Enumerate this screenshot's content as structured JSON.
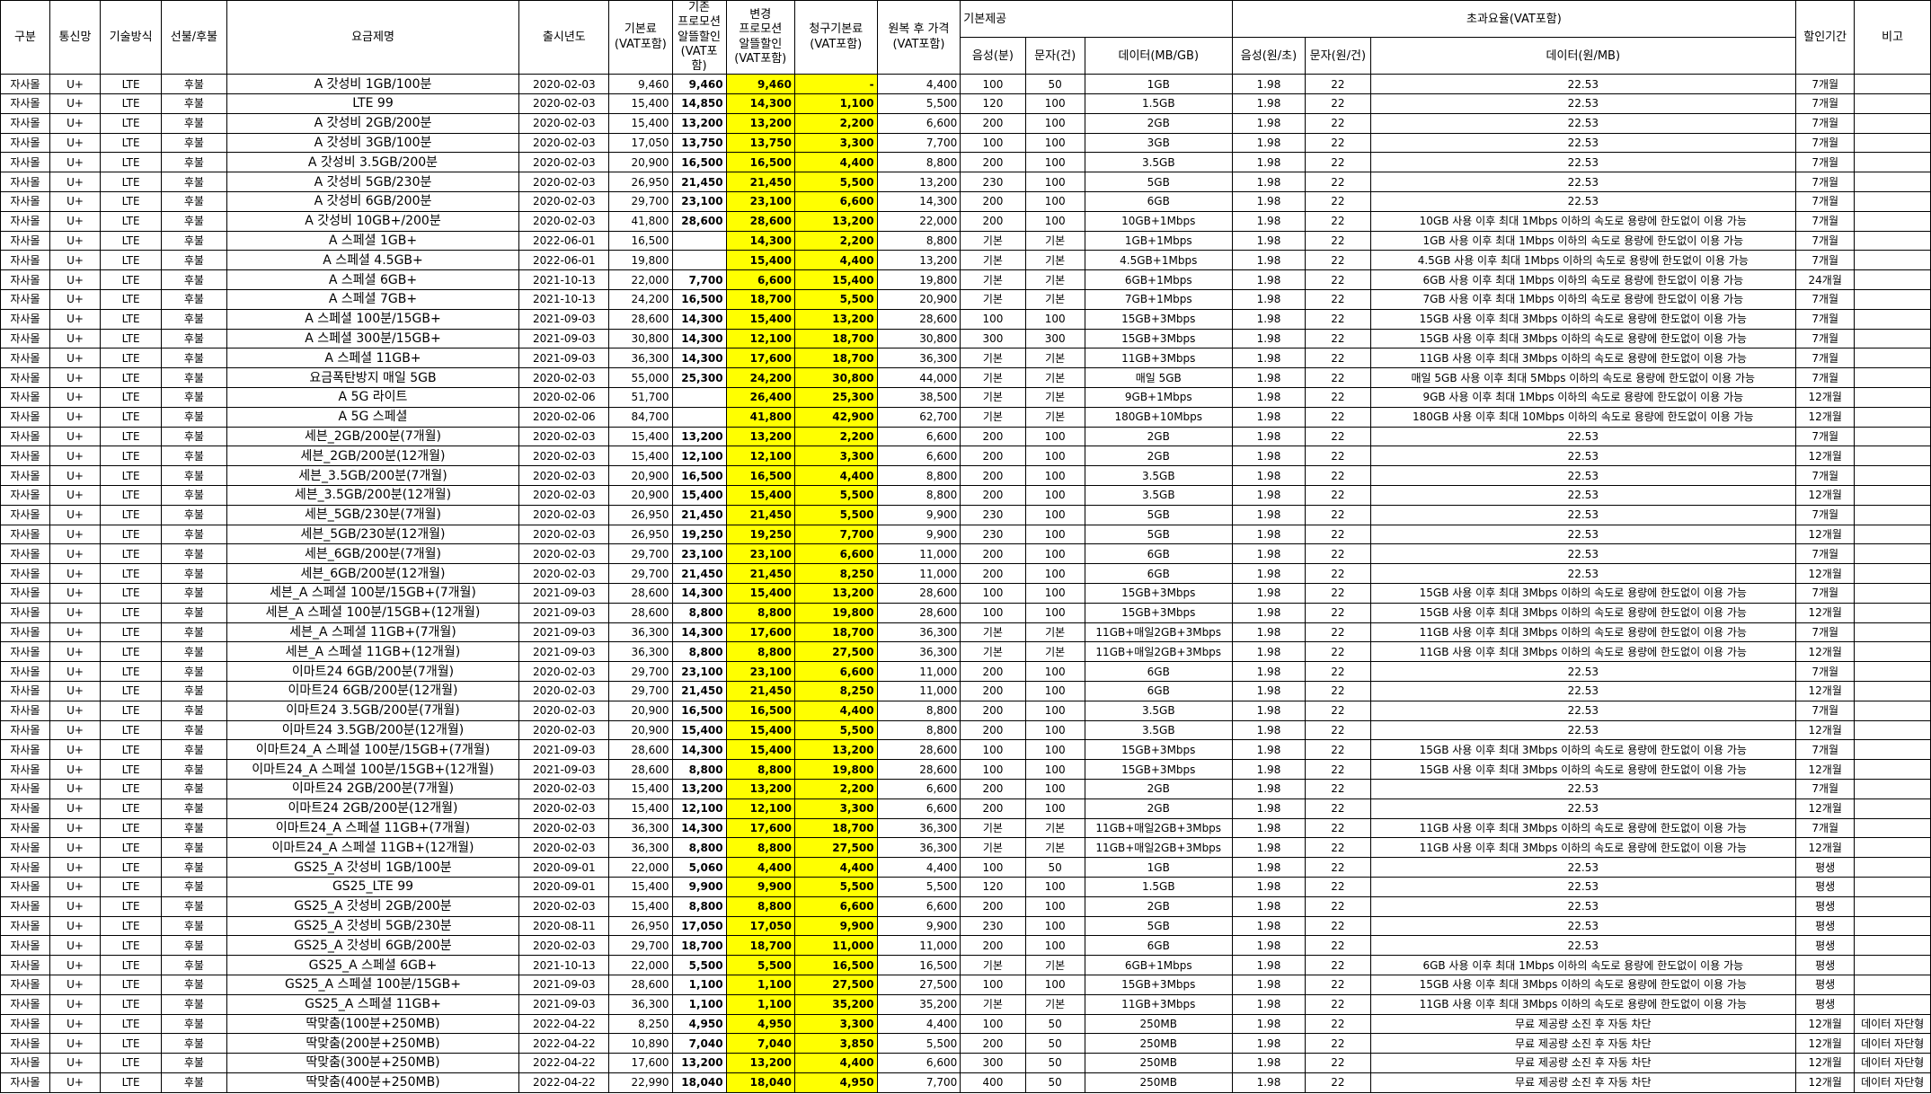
{
  "headers": {
    "category": "구분",
    "carrier": "통신망",
    "tech": "기술방식",
    "payment": "선불/후불",
    "plan": "요금제명",
    "release": "출시년도",
    "base_fee": "기본료\n(VAT포함)",
    "old_promo": "기존\n프로모션\n알뜰할인\n(VAT포함)",
    "new_promo": "변경\n프로모션\n알뜰할인\n(VAT포함)",
    "billed_fee": "청구기본료\n(VAT포함)",
    "restored_price": "원복 후 가격\n(VAT포함)",
    "basic_group": "기본제공",
    "voice": "음성(분)",
    "sms": "문자(건)",
    "data": "데이터(MB/GB)",
    "overage_group": "초과요율(VAT포함)",
    "ov_voice": "음성(원/초)",
    "ov_sms": "문자(원/건)",
    "ov_data": "데이터(원/MB)",
    "discount_period": "할인기간",
    "remarks": "비고"
  },
  "rows": [
    [
      "자사몰",
      "U+",
      "LTE",
      "후불",
      "A 갓성비 1GB/100분",
      "2020-02-03",
      "9,460",
      "9,460",
      "9,460",
      "-",
      "4,400",
      "100",
      "50",
      "1GB",
      "1.98",
      "22",
      "22.53",
      "7개월",
      ""
    ],
    [
      "자사몰",
      "U+",
      "LTE",
      "후불",
      "LTE 99",
      "2020-02-03",
      "15,400",
      "14,850",
      "14,300",
      "1,100",
      "5,500",
      "120",
      "100",
      "1.5GB",
      "1.98",
      "22",
      "22.53",
      "7개월",
      ""
    ],
    [
      "자사몰",
      "U+",
      "LTE",
      "후불",
      "A 갓성비 2GB/200분",
      "2020-02-03",
      "15,400",
      "13,200",
      "13,200",
      "2,200",
      "6,600",
      "200",
      "100",
      "2GB",
      "1.98",
      "22",
      "22.53",
      "7개월",
      ""
    ],
    [
      "자사몰",
      "U+",
      "LTE",
      "후불",
      "A 갓성비 3GB/100분",
      "2020-02-03",
      "17,050",
      "13,750",
      "13,750",
      "3,300",
      "7,700",
      "100",
      "100",
      "3GB",
      "1.98",
      "22",
      "22.53",
      "7개월",
      ""
    ],
    [
      "자사몰",
      "U+",
      "LTE",
      "후불",
      "A 갓성비 3.5GB/200분",
      "2020-02-03",
      "20,900",
      "16,500",
      "16,500",
      "4,400",
      "8,800",
      "200",
      "100",
      "3.5GB",
      "1.98",
      "22",
      "22.53",
      "7개월",
      ""
    ],
    [
      "자사몰",
      "U+",
      "LTE",
      "후불",
      "A 갓성비 5GB/230분",
      "2020-02-03",
      "26,950",
      "21,450",
      "21,450",
      "5,500",
      "13,200",
      "230",
      "100",
      "5GB",
      "1.98",
      "22",
      "22.53",
      "7개월",
      ""
    ],
    [
      "자사몰",
      "U+",
      "LTE",
      "후불",
      "A 갓성비 6GB/200분",
      "2020-02-03",
      "29,700",
      "23,100",
      "23,100",
      "6,600",
      "14,300",
      "200",
      "100",
      "6GB",
      "1.98",
      "22",
      "22.53",
      "7개월",
      ""
    ],
    [
      "자사몰",
      "U+",
      "LTE",
      "후불",
      "A 갓성비 10GB+/200분",
      "2020-02-03",
      "41,800",
      "28,600",
      "28,600",
      "13,200",
      "22,000",
      "200",
      "100",
      "10GB+1Mbps",
      "1.98",
      "22",
      "10GB 사용 이후 최대 1Mbps 이하의 속도로 용량에 한도없이 이용 가능",
      "7개월",
      ""
    ],
    [
      "자사몰",
      "U+",
      "LTE",
      "후불",
      "A 스페셜 1GB+",
      "2022-06-01",
      "16,500",
      "",
      "14,300",
      "2,200",
      "8,800",
      "기본",
      "기본",
      "1GB+1Mbps",
      "1.98",
      "22",
      "1GB 사용 이후 최대 1Mbps 이하의 속도로 용량에 한도없이 이용 가능",
      "7개월",
      ""
    ],
    [
      "자사몰",
      "U+",
      "LTE",
      "후불",
      "A 스페셜 4.5GB+",
      "2022-06-01",
      "19,800",
      "",
      "15,400",
      "4,400",
      "13,200",
      "기본",
      "기본",
      "4.5GB+1Mbps",
      "1.98",
      "22",
      "4.5GB 사용 이후 최대 1Mbps 이하의 속도로 용량에 한도없이 이용 가능",
      "7개월",
      ""
    ],
    [
      "자사몰",
      "U+",
      "LTE",
      "후불",
      "A 스페셜 6GB+",
      "2021-10-13",
      "22,000",
      "7,700",
      "6,600",
      "15,400",
      "19,800",
      "기본",
      "기본",
      "6GB+1Mbps",
      "1.98",
      "22",
      "6GB 사용 이후 최대 1Mbps 이하의 속도로 용량에 한도없이 이용 가능",
      "24개월",
      ""
    ],
    [
      "자사몰",
      "U+",
      "LTE",
      "후불",
      "A 스페셜 7GB+",
      "2021-10-13",
      "24,200",
      "16,500",
      "18,700",
      "5,500",
      "20,900",
      "기본",
      "기본",
      "7GB+1Mbps",
      "1.98",
      "22",
      "7GB 사용 이후 최대 1Mbps 이하의 속도로 용량에 한도없이 이용 가능",
      "7개월",
      ""
    ],
    [
      "자사몰",
      "U+",
      "LTE",
      "후불",
      "A 스페셜 100분/15GB+",
      "2021-09-03",
      "28,600",
      "14,300",
      "15,400",
      "13,200",
      "28,600",
      "100",
      "100",
      "15GB+3Mbps",
      "1.98",
      "22",
      "15GB 사용 이후 최대 3Mbps 이하의 속도로 용량에 한도없이 이용 가능",
      "7개월",
      ""
    ],
    [
      "자사몰",
      "U+",
      "LTE",
      "후불",
      "A 스페셜 300분/15GB+",
      "2021-09-03",
      "30,800",
      "14,300",
      "12,100",
      "18,700",
      "30,800",
      "300",
      "300",
      "15GB+3Mbps",
      "1.98",
      "22",
      "15GB 사용 이후 최대 3Mbps 이하의 속도로 용량에 한도없이 이용 가능",
      "7개월",
      ""
    ],
    [
      "자사몰",
      "U+",
      "LTE",
      "후불",
      "A 스페셜 11GB+",
      "2021-09-03",
      "36,300",
      "14,300",
      "17,600",
      "18,700",
      "36,300",
      "기본",
      "기본",
      "11GB+3Mbps",
      "1.98",
      "22",
      "11GB 사용 이후 최대 3Mbps 이하의 속도로 용량에 한도없이 이용 가능",
      "7개월",
      ""
    ],
    [
      "자사몰",
      "U+",
      "LTE",
      "후불",
      "요금폭탄방지 매일 5GB",
      "2020-02-03",
      "55,000",
      "25,300",
      "24,200",
      "30,800",
      "44,000",
      "기본",
      "기본",
      "매일 5GB",
      "1.98",
      "22",
      "매일 5GB 사용 이후 최대 5Mbps 이하의 속도로 용량에 한도없이 이용 가능",
      "7개월",
      ""
    ],
    [
      "자사몰",
      "U+",
      "LTE",
      "후불",
      "A 5G 라이트",
      "2020-02-06",
      "51,700",
      "",
      "26,400",
      "25,300",
      "38,500",
      "기본",
      "기본",
      "9GB+1Mbps",
      "1.98",
      "22",
      "9GB 사용 이후 최대 1Mbps 이하의 속도로 용량에 한도없이 이용 가능",
      "12개월",
      ""
    ],
    [
      "자사몰",
      "U+",
      "LTE",
      "후불",
      "A 5G 스페셜",
      "2020-02-06",
      "84,700",
      "",
      "41,800",
      "42,900",
      "62,700",
      "기본",
      "기본",
      "180GB+10Mbps",
      "1.98",
      "22",
      "180GB 사용 이후 최대 10Mbps 이하의 속도로 용량에 한도없이 이용 가능",
      "12개월",
      ""
    ],
    [
      "자사몰",
      "U+",
      "LTE",
      "후불",
      "세븐_2GB/200분(7개월)",
      "2020-02-03",
      "15,400",
      "13,200",
      "13,200",
      "2,200",
      "6,600",
      "200",
      "100",
      "2GB",
      "1.98",
      "22",
      "22.53",
      "7개월",
      ""
    ],
    [
      "자사몰",
      "U+",
      "LTE",
      "후불",
      "세븐_2GB/200분(12개월)",
      "2020-02-03",
      "15,400",
      "12,100",
      "12,100",
      "3,300",
      "6,600",
      "200",
      "100",
      "2GB",
      "1.98",
      "22",
      "22.53",
      "12개월",
      ""
    ],
    [
      "자사몰",
      "U+",
      "LTE",
      "후불",
      "세븐_3.5GB/200분(7개월)",
      "2020-02-03",
      "20,900",
      "16,500",
      "16,500",
      "4,400",
      "8,800",
      "200",
      "100",
      "3.5GB",
      "1.98",
      "22",
      "22.53",
      "7개월",
      ""
    ],
    [
      "자사몰",
      "U+",
      "LTE",
      "후불",
      "세븐_3.5GB/200분(12개월)",
      "2020-02-03",
      "20,900",
      "15,400",
      "15,400",
      "5,500",
      "8,800",
      "200",
      "100",
      "3.5GB",
      "1.98",
      "22",
      "22.53",
      "12개월",
      ""
    ],
    [
      "자사몰",
      "U+",
      "LTE",
      "후불",
      "세븐_5GB/230분(7개월)",
      "2020-02-03",
      "26,950",
      "21,450",
      "21,450",
      "5,500",
      "9,900",
      "230",
      "100",
      "5GB",
      "1.98",
      "22",
      "22.53",
      "7개월",
      ""
    ],
    [
      "자사몰",
      "U+",
      "LTE",
      "후불",
      "세븐_5GB/230분(12개월)",
      "2020-02-03",
      "26,950",
      "19,250",
      "19,250",
      "7,700",
      "9,900",
      "230",
      "100",
      "5GB",
      "1.98",
      "22",
      "22.53",
      "12개월",
      ""
    ],
    [
      "자사몰",
      "U+",
      "LTE",
      "후불",
      "세븐_6GB/200분(7개월)",
      "2020-02-03",
      "29,700",
      "23,100",
      "23,100",
      "6,600",
      "11,000",
      "200",
      "100",
      "6GB",
      "1.98",
      "22",
      "22.53",
      "7개월",
      ""
    ],
    [
      "자사몰",
      "U+",
      "LTE",
      "후불",
      "세븐_6GB/200분(12개월)",
      "2020-02-03",
      "29,700",
      "21,450",
      "21,450",
      "8,250",
      "11,000",
      "200",
      "100",
      "6GB",
      "1.98",
      "22",
      "22.53",
      "12개월",
      ""
    ],
    [
      "자사몰",
      "U+",
      "LTE",
      "후불",
      "세븐_A 스페셜 100분/15GB+(7개월)",
      "2021-09-03",
      "28,600",
      "14,300",
      "15,400",
      "13,200",
      "28,600",
      "100",
      "100",
      "15GB+3Mbps",
      "1.98",
      "22",
      "15GB 사용 이후 최대 3Mbps 이하의 속도로 용량에 한도없이 이용 가능",
      "7개월",
      ""
    ],
    [
      "자사몰",
      "U+",
      "LTE",
      "후불",
      "세븐_A 스페셜 100분/15GB+(12개월)",
      "2021-09-03",
      "28,600",
      "8,800",
      "8,800",
      "19,800",
      "28,600",
      "100",
      "100",
      "15GB+3Mbps",
      "1.98",
      "22",
      "15GB 사용 이후 최대 3Mbps 이하의 속도로 용량에 한도없이 이용 가능",
      "12개월",
      ""
    ],
    [
      "자사몰",
      "U+",
      "LTE",
      "후불",
      "세븐_A 스페셜 11GB+(7개월)",
      "2021-09-03",
      "36,300",
      "14,300",
      "17,600",
      "18,700",
      "36,300",
      "기본",
      "기본",
      "11GB+매일2GB+3Mbps",
      "1.98",
      "22",
      "11GB 사용 이후 최대 3Mbps 이하의 속도로 용량에 한도없이 이용 가능",
      "7개월",
      ""
    ],
    [
      "자사몰",
      "U+",
      "LTE",
      "후불",
      "세븐_A 스페셜 11GB+(12개월)",
      "2021-09-03",
      "36,300",
      "8,800",
      "8,800",
      "27,500",
      "36,300",
      "기본",
      "기본",
      "11GB+매일2GB+3Mbps",
      "1.98",
      "22",
      "11GB 사용 이후 최대 3Mbps 이하의 속도로 용량에 한도없이 이용 가능",
      "12개월",
      ""
    ],
    [
      "자사몰",
      "U+",
      "LTE",
      "후불",
      "이마트24 6GB/200분(7개월)",
      "2020-02-03",
      "29,700",
      "23,100",
      "23,100",
      "6,600",
      "11,000",
      "200",
      "100",
      "6GB",
      "1.98",
      "22",
      "22.53",
      "7개월",
      ""
    ],
    [
      "자사몰",
      "U+",
      "LTE",
      "후불",
      "이마트24 6GB/200분(12개월)",
      "2020-02-03",
      "29,700",
      "21,450",
      "21,450",
      "8,250",
      "11,000",
      "200",
      "100",
      "6GB",
      "1.98",
      "22",
      "22.53",
      "12개월",
      ""
    ],
    [
      "자사몰",
      "U+",
      "LTE",
      "후불",
      "이마트24 3.5GB/200분(7개월)",
      "2020-02-03",
      "20,900",
      "16,500",
      "16,500",
      "4,400",
      "8,800",
      "200",
      "100",
      "3.5GB",
      "1.98",
      "22",
      "22.53",
      "7개월",
      ""
    ],
    [
      "자사몰",
      "U+",
      "LTE",
      "후불",
      "이마트24 3.5GB/200분(12개월)",
      "2020-02-03",
      "20,900",
      "15,400",
      "15,400",
      "5,500",
      "8,800",
      "200",
      "100",
      "3.5GB",
      "1.98",
      "22",
      "22.53",
      "12개월",
      ""
    ],
    [
      "자사몰",
      "U+",
      "LTE",
      "후불",
      "이마트24_A 스페셜 100분/15GB+(7개월)",
      "2021-09-03",
      "28,600",
      "14,300",
      "15,400",
      "13,200",
      "28,600",
      "100",
      "100",
      "15GB+3Mbps",
      "1.98",
      "22",
      "15GB 사용 이후 최대 3Mbps 이하의 속도로 용량에 한도없이 이용 가능",
      "7개월",
      ""
    ],
    [
      "자사몰",
      "U+",
      "LTE",
      "후불",
      "이마트24_A 스페셜 100분/15GB+(12개월)",
      "2021-09-03",
      "28,600",
      "8,800",
      "8,800",
      "19,800",
      "28,600",
      "100",
      "100",
      "15GB+3Mbps",
      "1.98",
      "22",
      "15GB 사용 이후 최대 3Mbps 이하의 속도로 용량에 한도없이 이용 가능",
      "12개월",
      ""
    ],
    [
      "자사몰",
      "U+",
      "LTE",
      "후불",
      "이마트24 2GB/200분(7개월)",
      "2020-02-03",
      "15,400",
      "13,200",
      "13,200",
      "2,200",
      "6,600",
      "200",
      "100",
      "2GB",
      "1.98",
      "22",
      "22.53",
      "7개월",
      ""
    ],
    [
      "자사몰",
      "U+",
      "LTE",
      "후불",
      "이마트24 2GB/200분(12개월)",
      "2020-02-03",
      "15,400",
      "12,100",
      "12,100",
      "3,300",
      "6,600",
      "200",
      "100",
      "2GB",
      "1.98",
      "22",
      "22.53",
      "12개월",
      ""
    ],
    [
      "자사몰",
      "U+",
      "LTE",
      "후불",
      "이마트24_A 스페셜 11GB+(7개월)",
      "2020-02-03",
      "36,300",
      "14,300",
      "17,600",
      "18,700",
      "36,300",
      "기본",
      "기본",
      "11GB+매일2GB+3Mbps",
      "1.98",
      "22",
      "11GB 사용 이후 최대 3Mbps 이하의 속도로 용량에 한도없이 이용 가능",
      "7개월",
      ""
    ],
    [
      "자사몰",
      "U+",
      "LTE",
      "후불",
      "이마트24_A 스페셜 11GB+(12개월)",
      "2020-02-03",
      "36,300",
      "8,800",
      "8,800",
      "27,500",
      "36,300",
      "기본",
      "기본",
      "11GB+매일2GB+3Mbps",
      "1.98",
      "22",
      "11GB 사용 이후 최대 3Mbps 이하의 속도로 용량에 한도없이 이용 가능",
      "12개월",
      ""
    ],
    [
      "자사몰",
      "U+",
      "LTE",
      "후불",
      "GS25_A 갓성비 1GB/100분",
      "2020-09-01",
      "22,000",
      "5,060",
      "4,400",
      "4,400",
      "4,400",
      "100",
      "50",
      "1GB",
      "1.98",
      "22",
      "22.53",
      "평생",
      ""
    ],
    [
      "자사몰",
      "U+",
      "LTE",
      "후불",
      "GS25_LTE 99",
      "2020-09-01",
      "15,400",
      "9,900",
      "9,900",
      "5,500",
      "5,500",
      "120",
      "100",
      "1.5GB",
      "1.98",
      "22",
      "22.53",
      "평생",
      ""
    ],
    [
      "자사몰",
      "U+",
      "LTE",
      "후불",
      "GS25_A 갓성비 2GB/200분",
      "2020-02-03",
      "15,400",
      "8,800",
      "8,800",
      "6,600",
      "6,600",
      "200",
      "100",
      "2GB",
      "1.98",
      "22",
      "22.53",
      "평생",
      ""
    ],
    [
      "자사몰",
      "U+",
      "LTE",
      "후불",
      "GS25_A 갓성비 5GB/230분",
      "2020-08-11",
      "26,950",
      "17,050",
      "17,050",
      "9,900",
      "9,900",
      "230",
      "100",
      "5GB",
      "1.98",
      "22",
      "22.53",
      "평생",
      ""
    ],
    [
      "자사몰",
      "U+",
      "LTE",
      "후불",
      "GS25_A 갓성비 6GB/200분",
      "2020-02-03",
      "29,700",
      "18,700",
      "18,700",
      "11,000",
      "11,000",
      "200",
      "100",
      "6GB",
      "1.98",
      "22",
      "22.53",
      "평생",
      ""
    ],
    [
      "자사몰",
      "U+",
      "LTE",
      "후불",
      "GS25_A 스페셜 6GB+",
      "2021-10-13",
      "22,000",
      "5,500",
      "5,500",
      "16,500",
      "16,500",
      "기본",
      "기본",
      "6GB+1Mbps",
      "1.98",
      "22",
      "6GB 사용 이후 최대 1Mbps 이하의 속도로 용량에 한도없이 이용 가능",
      "평생",
      ""
    ],
    [
      "자사몰",
      "U+",
      "LTE",
      "후불",
      "GS25_A 스페셜 100분/15GB+",
      "2021-09-03",
      "28,600",
      "1,100",
      "1,100",
      "27,500",
      "27,500",
      "100",
      "100",
      "15GB+3Mbps",
      "1.98",
      "22",
      "15GB 사용 이후 최대 3Mbps 이하의 속도로 용량에 한도없이 이용 가능",
      "평생",
      ""
    ],
    [
      "자사몰",
      "U+",
      "LTE",
      "후불",
      "GS25_A 스페셜 11GB+",
      "2021-09-03",
      "36,300",
      "1,100",
      "1,100",
      "35,200",
      "35,200",
      "기본",
      "기본",
      "11GB+3Mbps",
      "1.98",
      "22",
      "11GB 사용 이후 최대 3Mbps 이하의 속도로 용량에 한도없이 이용 가능",
      "평생",
      ""
    ],
    [
      "자사몰",
      "U+",
      "LTE",
      "후불",
      "딱맞춤(100분+250MB)",
      "2022-04-22",
      "8,250",
      "4,950",
      "4,950",
      "3,300",
      "4,400",
      "100",
      "50",
      "250MB",
      "1.98",
      "22",
      "무료 제공량 소진 후 자동 차단",
      "12개월",
      "데이터 자단형"
    ],
    [
      "자사몰",
      "U+",
      "LTE",
      "후불",
      "딱맞춤(200분+250MB)",
      "2022-04-22",
      "10,890",
      "7,040",
      "7,040",
      "3,850",
      "5,500",
      "200",
      "50",
      "250MB",
      "1.98",
      "22",
      "무료 제공량 소진 후 자동 차단",
      "12개월",
      "데이터 자단형"
    ],
    [
      "자사몰",
      "U+",
      "LTE",
      "후불",
      "딱맞춤(300분+250MB)",
      "2022-04-22",
      "17,600",
      "13,200",
      "13,200",
      "4,400",
      "6,600",
      "300",
      "50",
      "250MB",
      "1.98",
      "22",
      "무료 제공량 소진 후 자동 차단",
      "12개월",
      "데이터 자단형"
    ],
    [
      "자사몰",
      "U+",
      "LTE",
      "후불",
      "딱맞춤(400분+250MB)",
      "2022-04-22",
      "22,990",
      "18,040",
      "18,040",
      "4,950",
      "7,700",
      "400",
      "50",
      "250MB",
      "1.98",
      "22",
      "무료 제공량 소진 후 자동 차단",
      "12개월",
      "데이터 자단형"
    ]
  ]
}
